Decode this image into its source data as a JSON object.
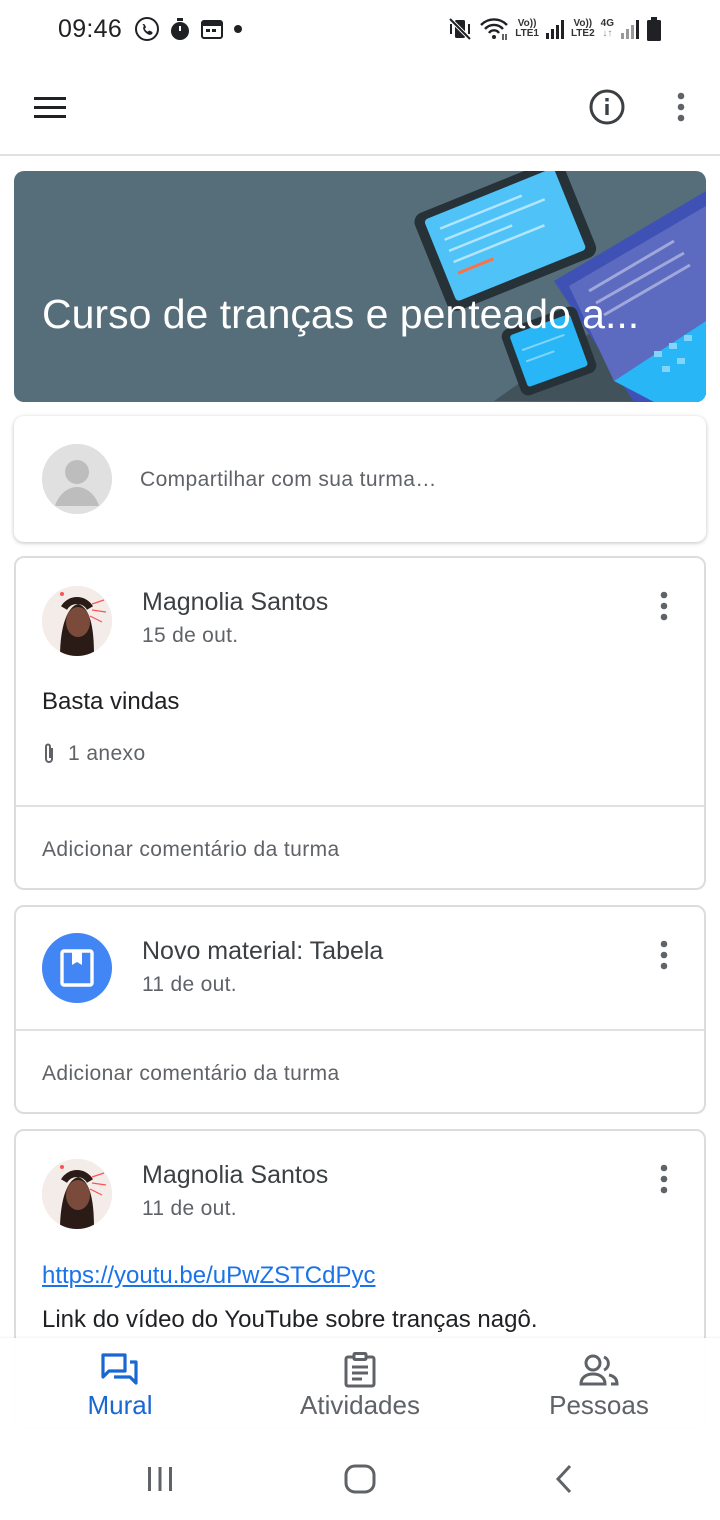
{
  "status_bar": {
    "time": "09:46",
    "net1": {
      "top": "Vo))",
      "bottom": "LTE1"
    },
    "net2": {
      "top": "Vo))",
      "bottom": "LTE2"
    },
    "net3": {
      "top": "4G"
    }
  },
  "banner": {
    "title": "Curso de tranças  e penteado a..."
  },
  "share": {
    "placeholder": "Compartilhar com sua turma…"
  },
  "posts": [
    {
      "author": "Magnolia Santos",
      "date": "15 de out.",
      "body": "Basta vindas",
      "attachments": "1 anexo",
      "comment_prompt": "Adicionar comentário da turma"
    },
    {
      "title": "Novo material: Tabela",
      "date": "11 de out.",
      "comment_prompt": "Adicionar comentário da turma"
    },
    {
      "author": "Magnolia Santos",
      "date": "11 de out.",
      "link": "https://youtu.be/uPwZSTCdPyc",
      "body": "Link do vídeo do YouTube sobre tranças nagô."
    }
  ],
  "bottom_nav": {
    "items": [
      {
        "label": "Mural",
        "icon": "stream-icon",
        "active": true
      },
      {
        "label": "Atividades",
        "icon": "classwork-icon",
        "active": false
      },
      {
        "label": "Pessoas",
        "icon": "people-icon",
        "active": false
      }
    ]
  },
  "colors": {
    "accent": "#1967d2",
    "banner": "#566e7a",
    "material_icon_bg": "#4285f4"
  }
}
